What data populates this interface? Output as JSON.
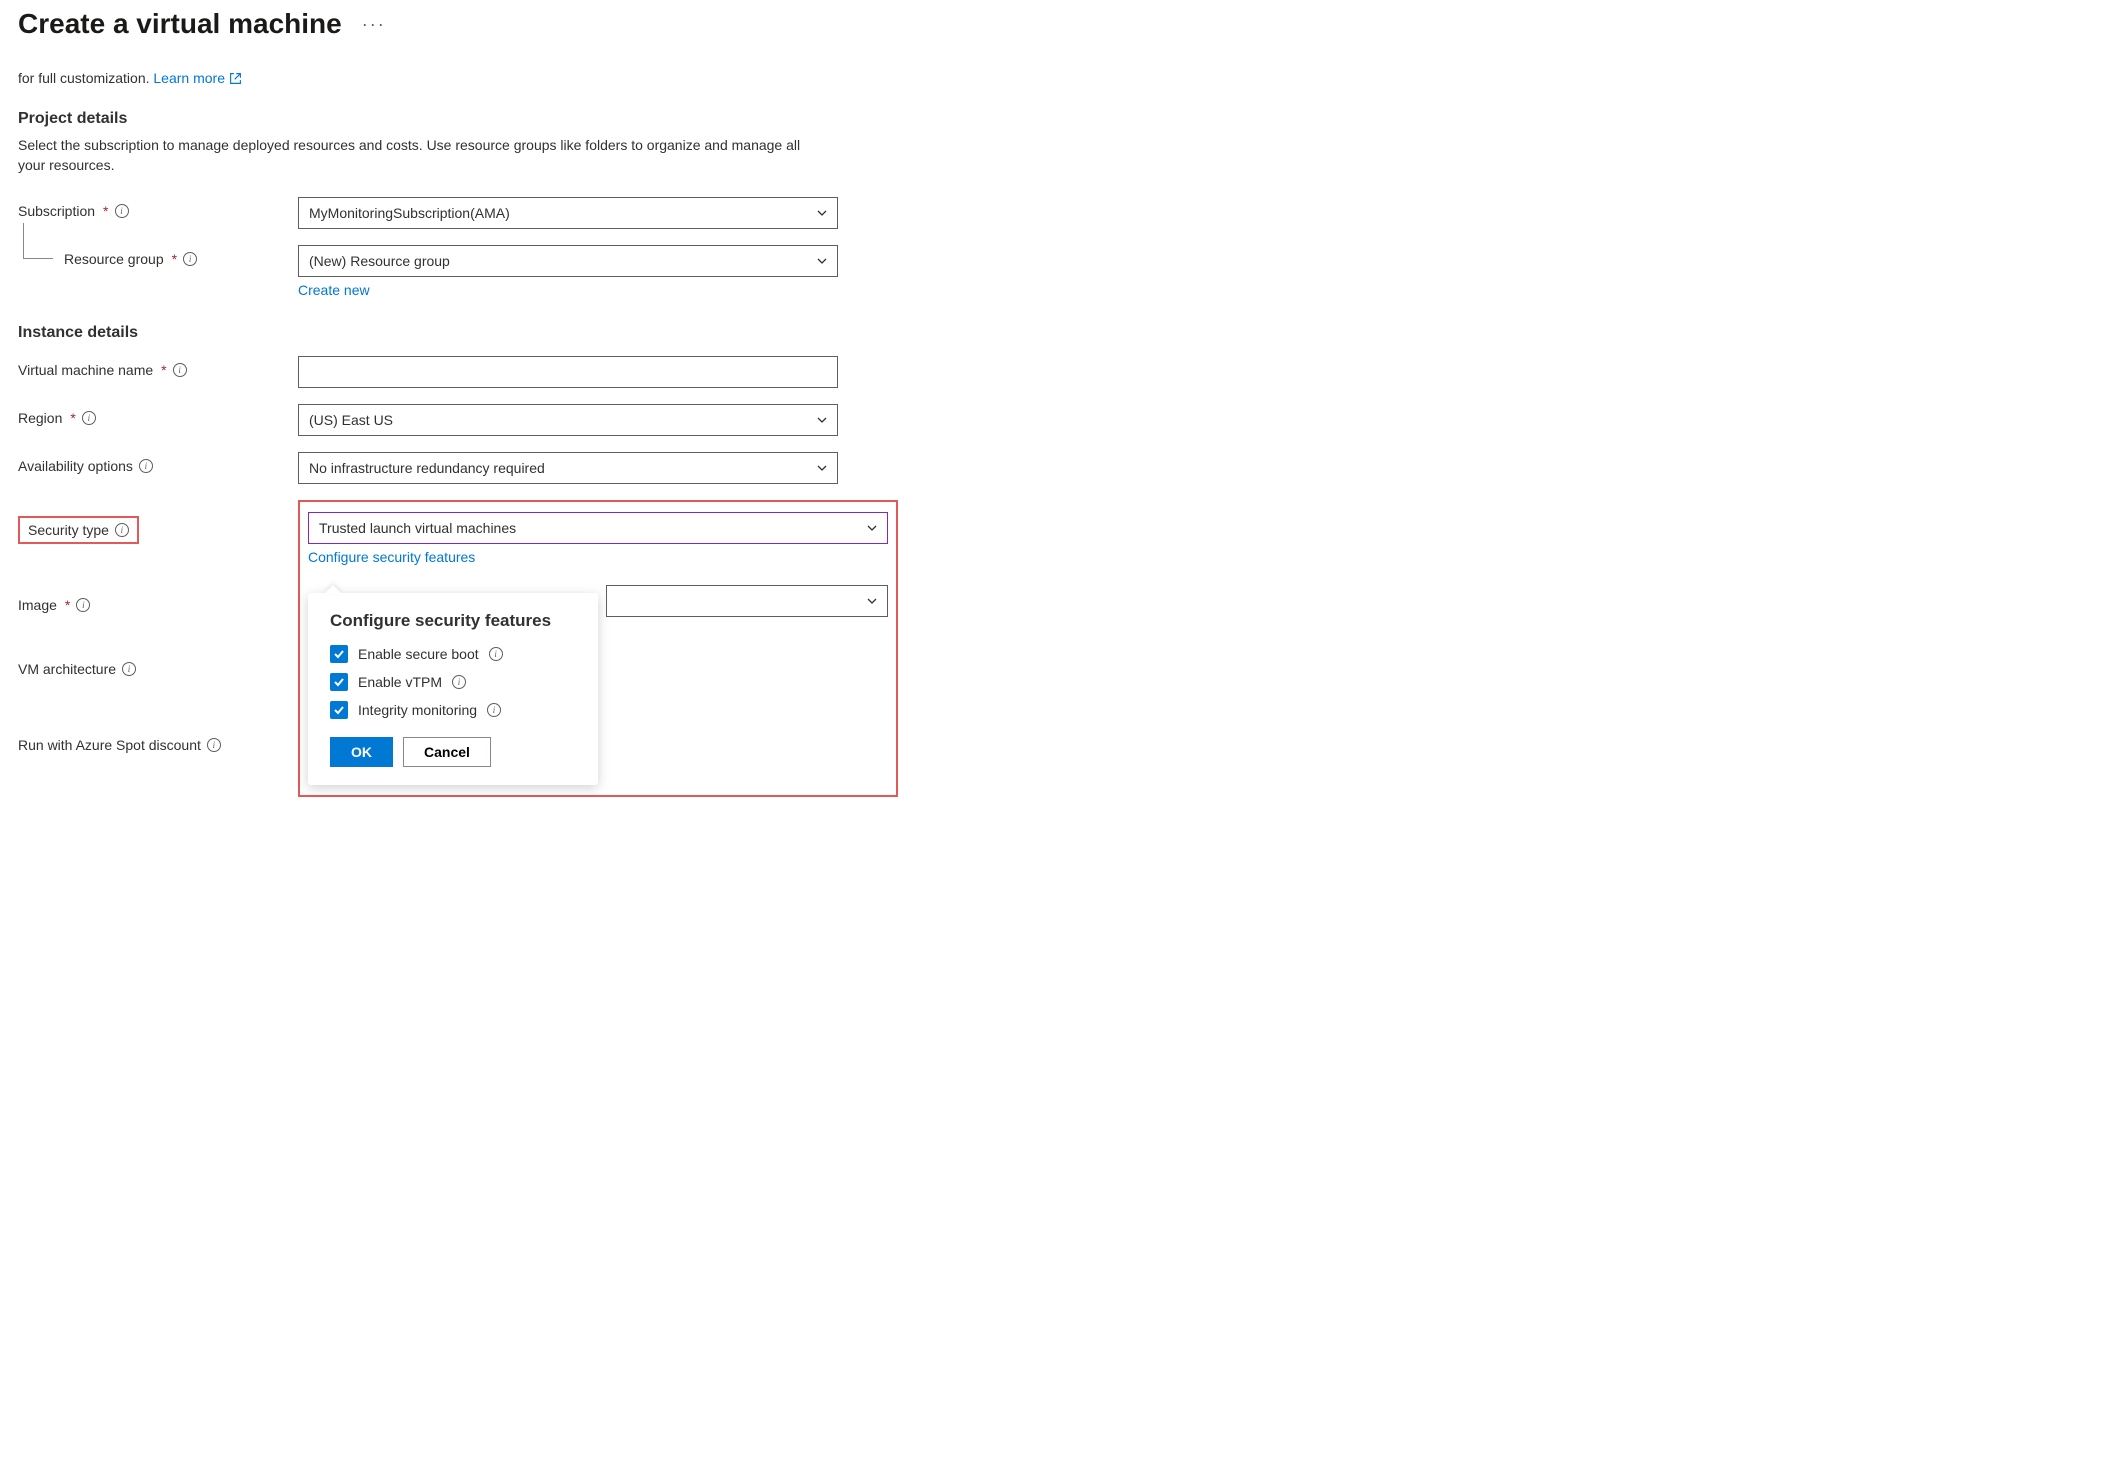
{
  "page": {
    "title": "Create a virtual machine"
  },
  "intro": {
    "prefix": "for full customization. ",
    "link": "Learn more"
  },
  "project": {
    "heading": "Project details",
    "desc": "Select the subscription to manage deployed resources and costs. Use resource groups like folders to organize and manage all your resources."
  },
  "fields": {
    "subscription": {
      "label": "Subscription",
      "value": "MyMonitoringSubscription(AMA)"
    },
    "resourceGroup": {
      "label": "Resource group",
      "value": "(New) Resource group",
      "createNew": "Create new"
    },
    "instanceHeading": "Instance details",
    "vmName": {
      "label": "Virtual machine name",
      "value": ""
    },
    "region": {
      "label": "Region",
      "value": "(US) East US"
    },
    "availability": {
      "label": "Availability options",
      "value": "No infrastructure redundancy required"
    },
    "securityType": {
      "label": "Security type",
      "value": "Trusted launch virtual machines",
      "configLink": "Configure security features"
    },
    "image": {
      "label": "Image",
      "value": ""
    },
    "vmArch": {
      "label": "VM architecture"
    },
    "spot": {
      "label": "Run with Azure Spot discount"
    }
  },
  "popover": {
    "title": "Configure security features",
    "opts": [
      {
        "label": "Enable secure boot"
      },
      {
        "label": "Enable vTPM"
      },
      {
        "label": "Integrity monitoring"
      }
    ],
    "ok": "OK",
    "cancel": "Cancel"
  }
}
